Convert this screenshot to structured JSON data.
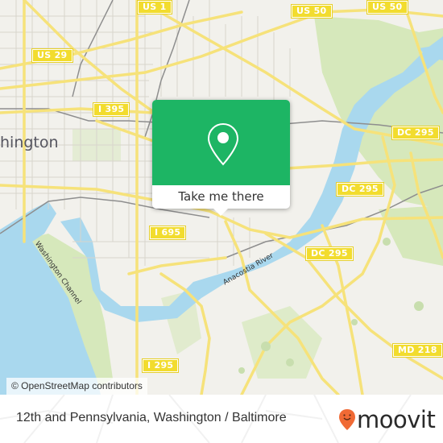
{
  "map": {
    "city_label": "hington",
    "water_labels": [
      "Washington Channel",
      "Anacostia River"
    ],
    "road_shields": [
      "US 1",
      "US 50",
      "US 50",
      "US 29",
      "I 395",
      "DC 295",
      "DC 295",
      "DC 295",
      "I 695",
      "I 295",
      "MD 218"
    ],
    "colors": {
      "land": "#f2f1ec",
      "water": "#a9d8ee",
      "park": "#d6e8bb",
      "road": "#f6e27a",
      "shield": "#f2dc2e"
    }
  },
  "attribution": "© OpenStreetMap contributors",
  "popup": {
    "icon": "location-pin-icon",
    "cta_label": "Take me there",
    "color": "#1db564"
  },
  "footer": {
    "place_title": "12th and Pennsylvania, Washington / Baltimore",
    "logo_text": "moovit",
    "logo_color": "#f06a35"
  }
}
